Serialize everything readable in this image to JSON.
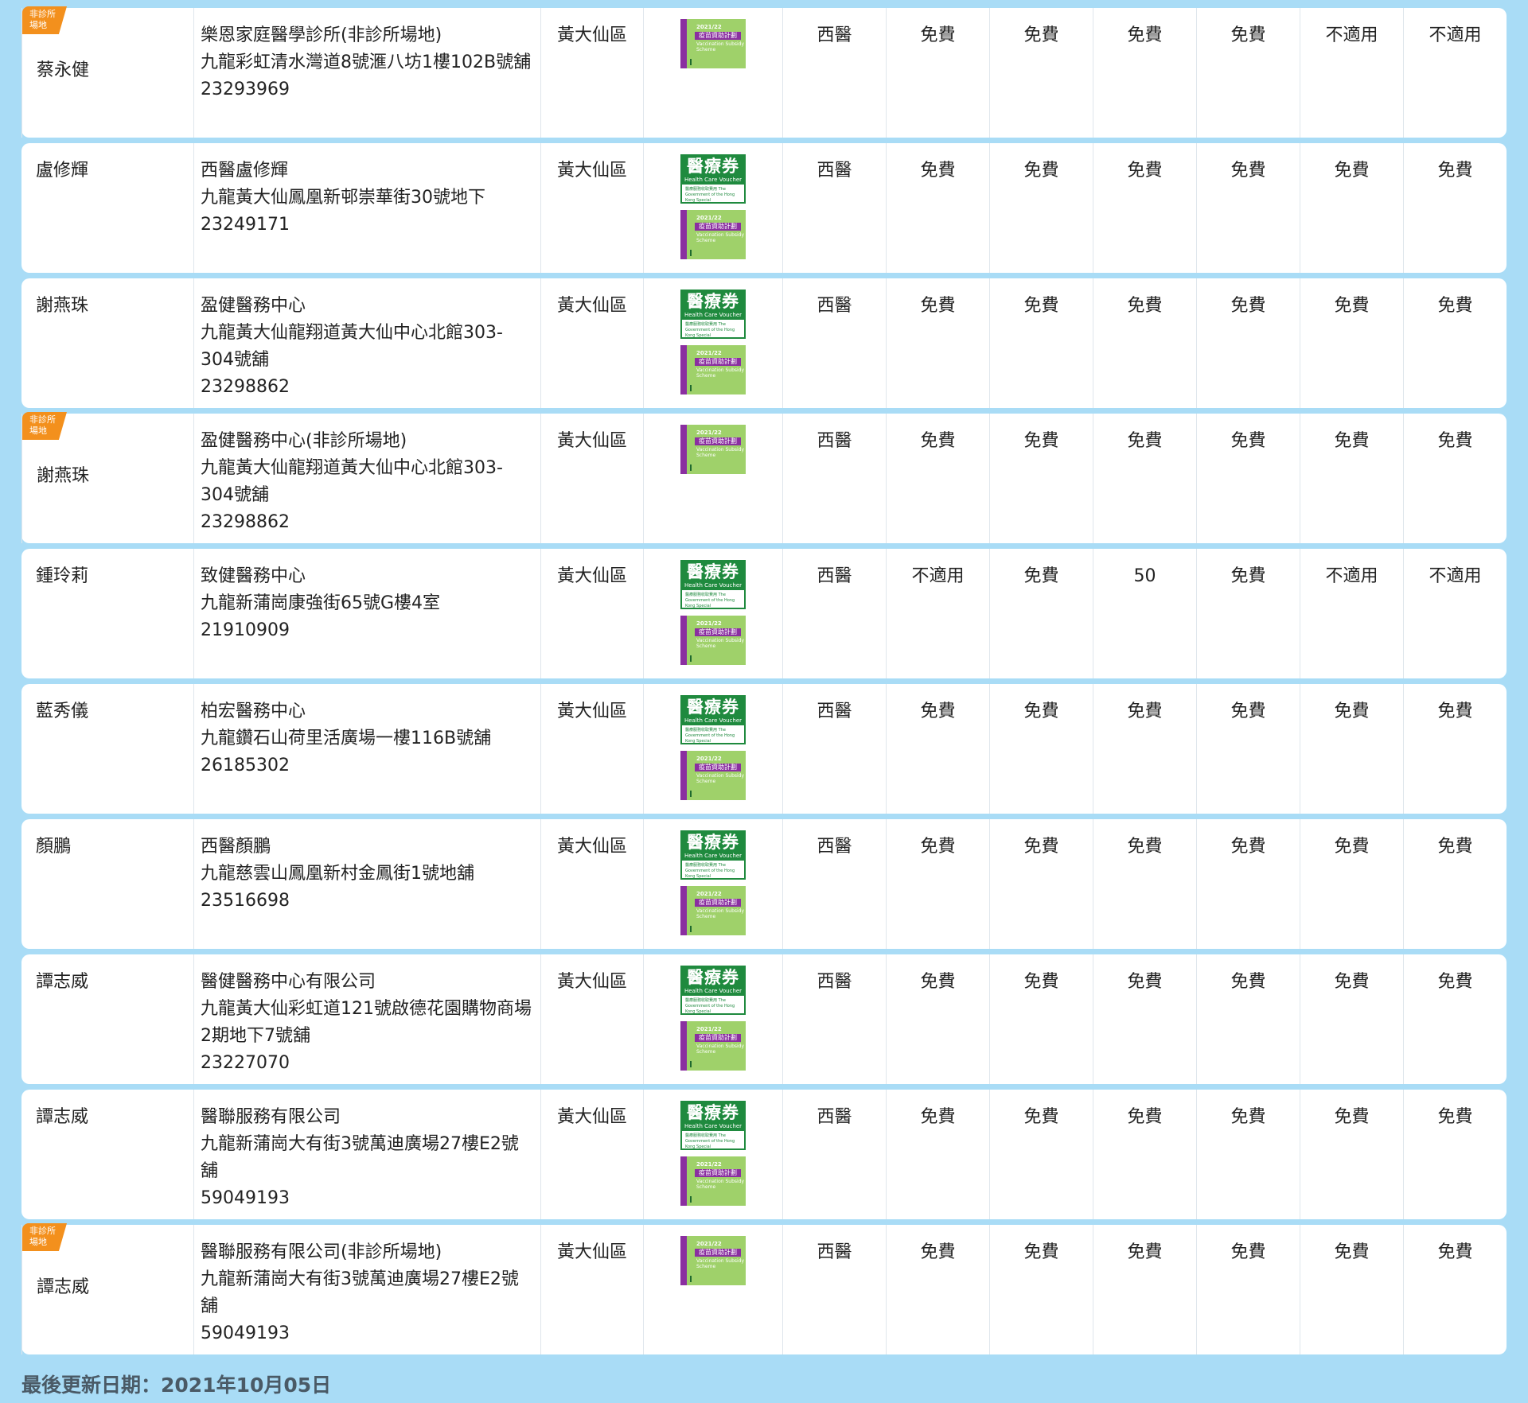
{
  "badge_label": "非診所\n場地",
  "scheme_logos": {
    "hcv_title": "醫療券",
    "hcv_sub": "Health Care Voucher",
    "hcv_small": "醫療服務收取費用 The Government of the Hong Kong Special Administrative Region",
    "vss_year": "2021/22",
    "vss_title": "疫苗資助計劃",
    "vss_en": "Vaccination Subsidy Scheme"
  },
  "rows": [
    {
      "badge": true,
      "doctor": "蔡永健",
      "clinic_name": "樂恩家庭醫學診所(非診所場地)",
      "address": "九龍彩虹清水灣道8號滙八坊1樓102B號舖",
      "phone": "23293969",
      "district": "黃大仙區",
      "hcv": false,
      "vss": true,
      "type": "西醫",
      "v1": "免費",
      "v2": "免費",
      "v3": "免費",
      "v4": "免費",
      "v5": "不適用",
      "v6": "不適用"
    },
    {
      "badge": false,
      "doctor": "盧修輝",
      "clinic_name": "西醫盧修輝",
      "address": "九龍黃大仙鳳凰新邨崇華街30號地下",
      "phone": "23249171",
      "district": "黃大仙區",
      "hcv": true,
      "vss": true,
      "type": "西醫",
      "v1": "免費",
      "v2": "免費",
      "v3": "免費",
      "v4": "免費",
      "v5": "免費",
      "v6": "免費"
    },
    {
      "badge": false,
      "doctor": "謝燕珠",
      "clinic_name": "盈健醫務中心",
      "address": "九龍黃大仙龍翔道黃大仙中心北館303-304號舖",
      "phone": "23298862",
      "district": "黃大仙區",
      "hcv": true,
      "vss": true,
      "type": "西醫",
      "v1": "免費",
      "v2": "免費",
      "v3": "免費",
      "v4": "免費",
      "v5": "免費",
      "v6": "免費"
    },
    {
      "badge": true,
      "doctor": "謝燕珠",
      "clinic_name": "盈健醫務中心(非診所場地)",
      "address": "九龍黃大仙龍翔道黃大仙中心北館303-304號舖",
      "phone": "23298862",
      "district": "黃大仙區",
      "hcv": false,
      "vss": true,
      "type": "西醫",
      "v1": "免費",
      "v2": "免費",
      "v3": "免費",
      "v4": "免費",
      "v5": "免費",
      "v6": "免費"
    },
    {
      "badge": false,
      "doctor": "鍾玲莉",
      "clinic_name": "致健醫務中心",
      "address": "九龍新蒲崗康強街65號G樓4室",
      "phone": "21910909",
      "district": "黃大仙區",
      "hcv": true,
      "vss": true,
      "type": "西醫",
      "v1": "不適用",
      "v2": "免費",
      "v3": "50",
      "v4": "免費",
      "v5": "不適用",
      "v6": "不適用"
    },
    {
      "badge": false,
      "doctor": "藍秀儀",
      "clinic_name": "柏宏醫務中心",
      "address": "九龍鑽石山荷里活廣場一樓116B號舖",
      "phone": "26185302",
      "district": "黃大仙區",
      "hcv": true,
      "vss": true,
      "type": "西醫",
      "v1": "免費",
      "v2": "免費",
      "v3": "免費",
      "v4": "免費",
      "v5": "免費",
      "v6": "免費"
    },
    {
      "badge": false,
      "doctor": "顏鵬",
      "clinic_name": "西醫顏鵬",
      "address": "九龍慈雲山鳳凰新村金鳳街1號地舖",
      "phone": "23516698",
      "district": "黃大仙區",
      "hcv": true,
      "vss": true,
      "type": "西醫",
      "v1": "免費",
      "v2": "免費",
      "v3": "免費",
      "v4": "免費",
      "v5": "免費",
      "v6": "免費"
    },
    {
      "badge": false,
      "doctor": "譚志威",
      "clinic_name": "醫健醫務中心有限公司",
      "address": "九龍黃大仙彩虹道121號啟德花園購物商場2期地下7號舖",
      "phone": "23227070",
      "district": "黃大仙區",
      "hcv": true,
      "vss": true,
      "type": "西醫",
      "v1": "免費",
      "v2": "免費",
      "v3": "免費",
      "v4": "免費",
      "v5": "免費",
      "v6": "免費"
    },
    {
      "badge": false,
      "doctor": "譚志威",
      "clinic_name": "醫聯服務有限公司",
      "address": "九龍新蒲崗大有街3號萬迪廣場27樓E2號舖",
      "phone": "59049193",
      "district": "黃大仙區",
      "hcv": true,
      "vss": true,
      "type": "西醫",
      "v1": "免費",
      "v2": "免費",
      "v3": "免費",
      "v4": "免費",
      "v5": "免費",
      "v6": "免費"
    },
    {
      "badge": true,
      "doctor": "譚志威",
      "clinic_name": "醫聯服務有限公司(非診所場地)",
      "address": "九龍新蒲崗大有街3號萬迪廣場27樓E2號舖",
      "phone": "59049193",
      "district": "黃大仙區",
      "hcv": false,
      "vss": true,
      "type": "西醫",
      "v1": "免費",
      "v2": "免費",
      "v3": "免費",
      "v4": "免費",
      "v5": "免費",
      "v6": "免費"
    }
  ],
  "footer": {
    "last_updated": "最後更新日期：2021年10月05日"
  }
}
